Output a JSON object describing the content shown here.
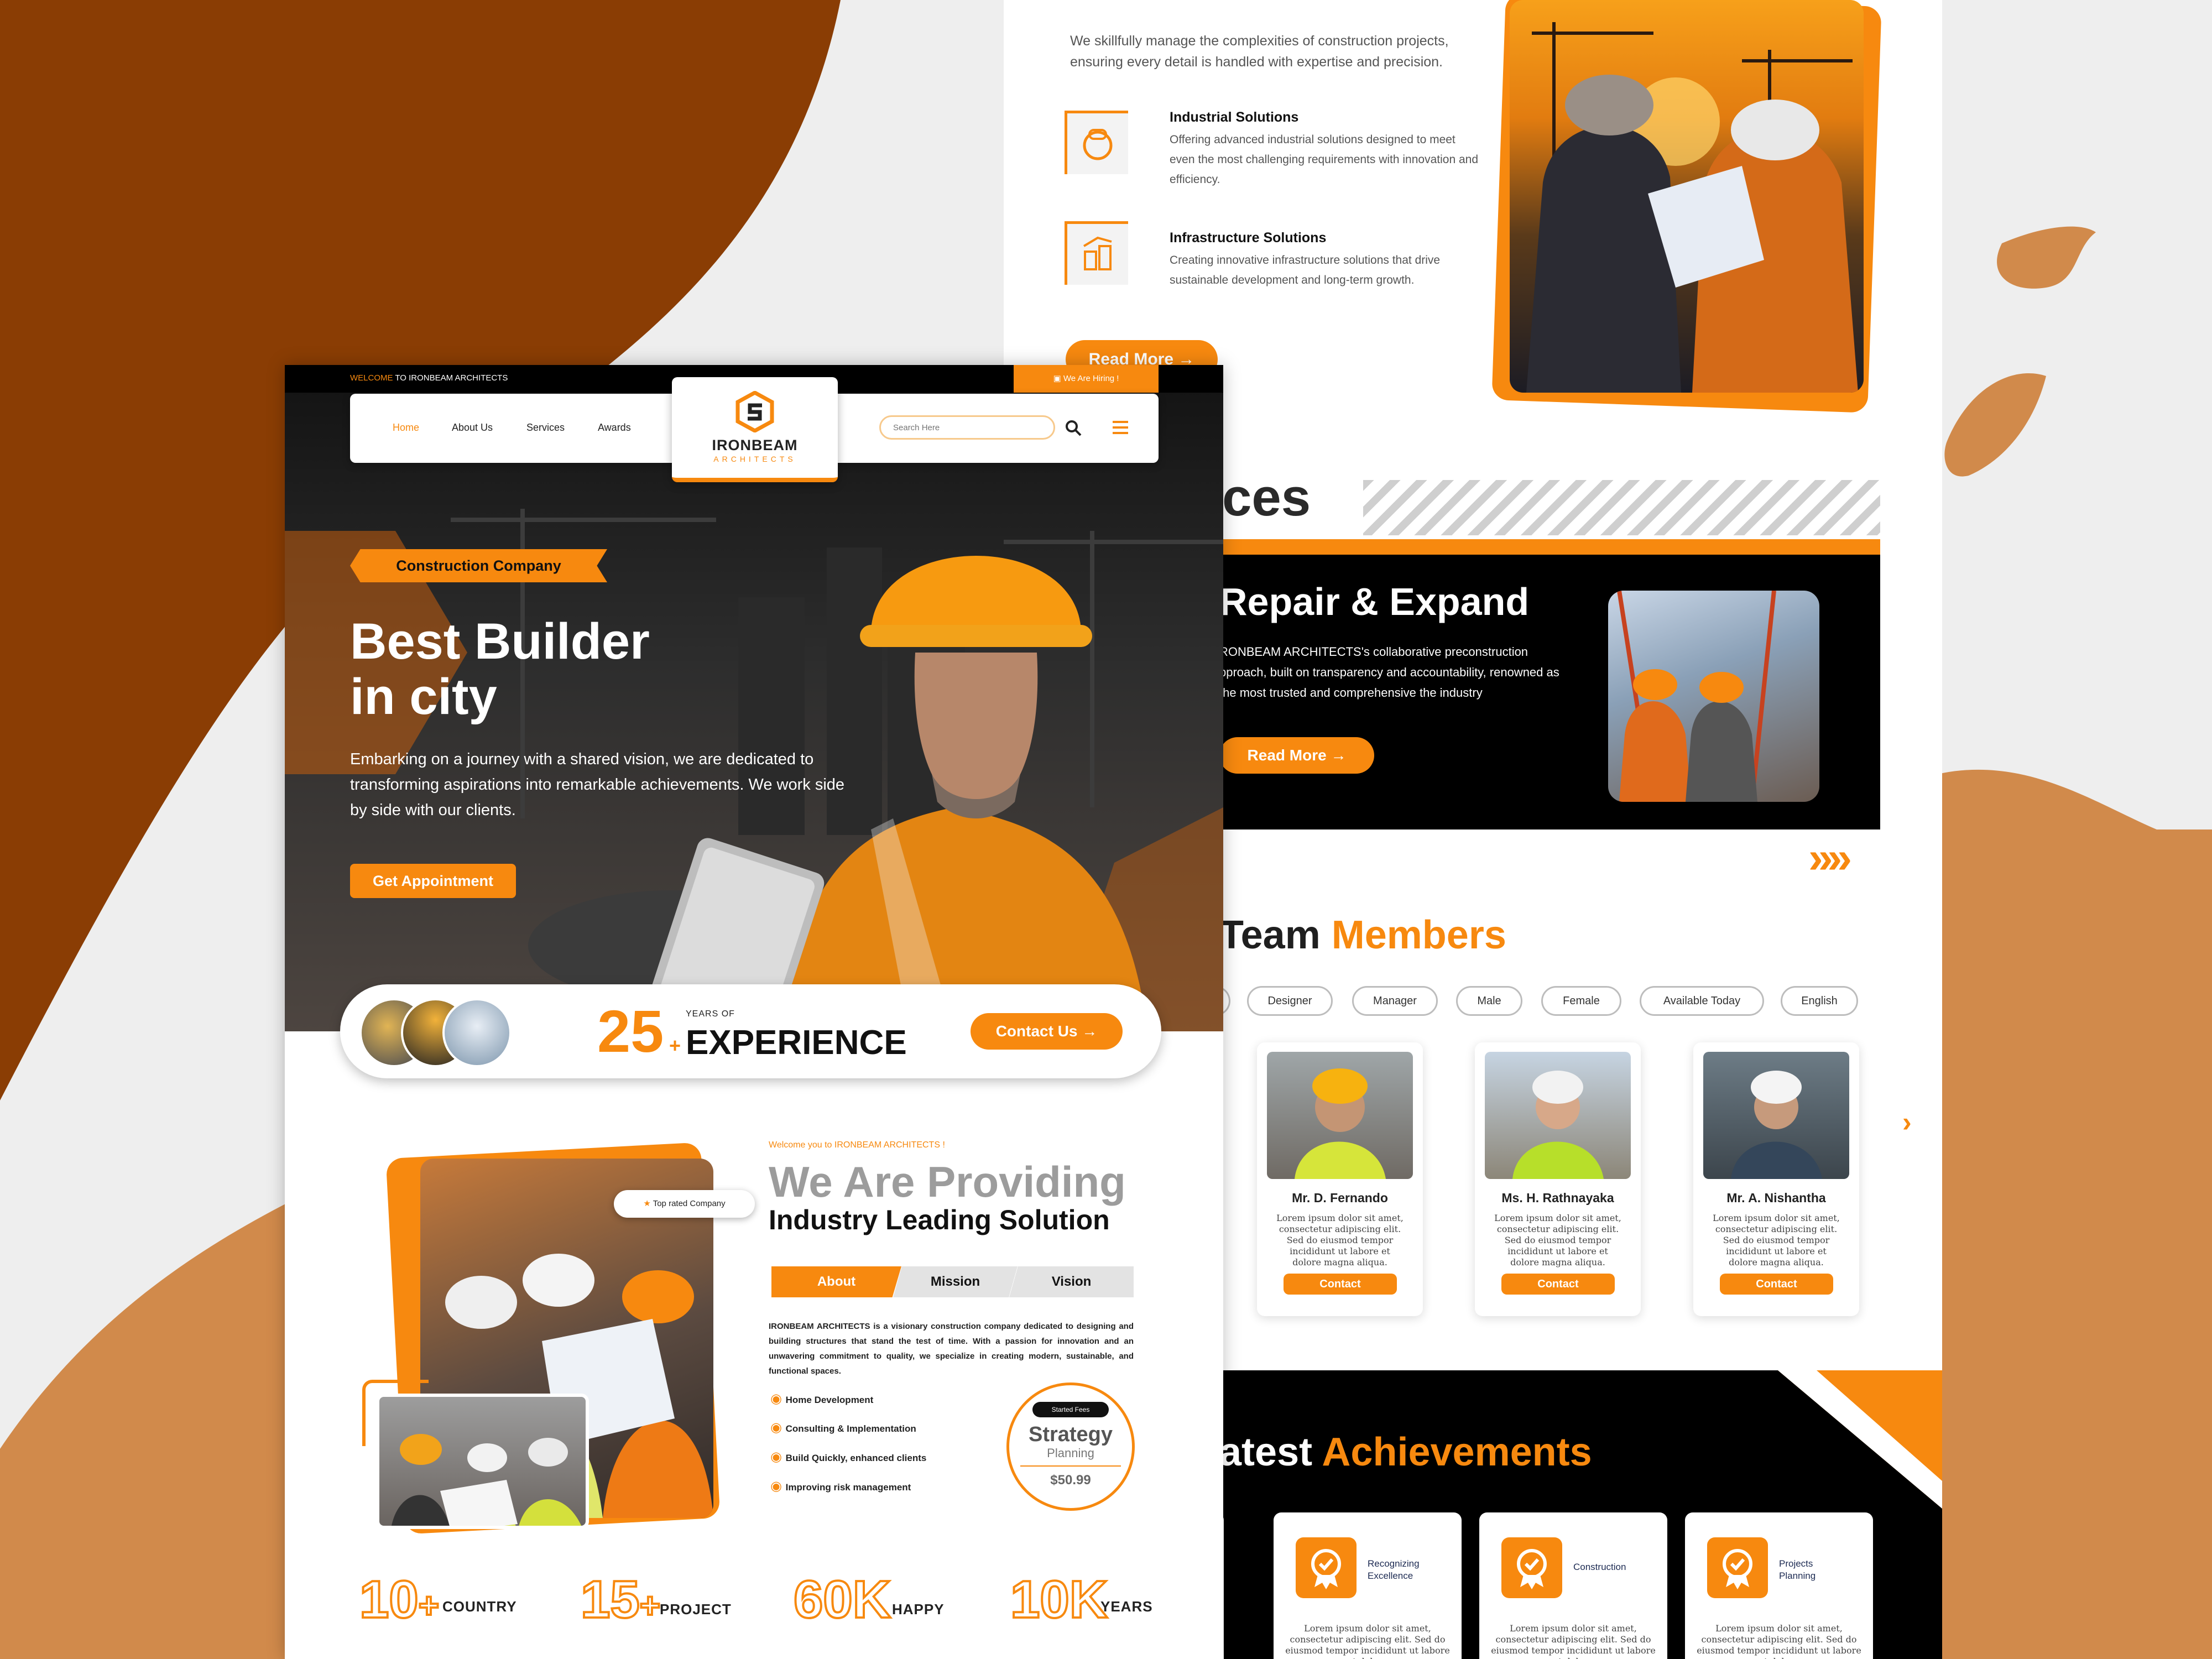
{
  "colors": {
    "accent": "#f7890f",
    "dark_brown": "#8a3d04",
    "tan": "#d18a4b",
    "black": "#000000"
  },
  "right_page": {
    "intro": "We skillfully manage the complexities of construction projects, ensuring every detail is handled with expertise and precision.",
    "features": [
      {
        "icon": "gear-worker-icon",
        "title": "Industrial Solutions",
        "desc": "Offering advanced industrial solutions designed to meet even the most challenging requirements with innovation and efficiency."
      },
      {
        "icon": "building-chart-icon",
        "title": "Infrastructure Solutions",
        "desc": "Creating innovative infrastructure solutions that drive sustainable development and long-term growth."
      }
    ],
    "read_more_1": "Read More →",
    "services_heading": "ces",
    "service_title": "Repair & Expand",
    "service_desc": "RONBEAM ARCHITECTS's collaborative preconstruction pproach, built on transparency and accountability, renowned as the most trusted and comprehensive the industry",
    "read_more_2": "Read More →",
    "next_arrows": "»»",
    "team_heading_a": "Team ",
    "team_heading_b": "Members",
    "filters": [
      "Designer",
      "Manager",
      "Male",
      "Female",
      "Available Today",
      "English"
    ],
    "members": [
      {
        "name": "Mr. D. Fernando",
        "desc": "Lorem ipsum dolor sit amet, consectetur adipiscing elit. Sed do eiusmod tempor incididunt ut labore et dolore magna aliqua.",
        "button": "Contact"
      },
      {
        "name": "Ms. H. Rathnayaka",
        "desc": "Lorem ipsum dolor sit amet, consectetur adipiscing elit. Sed do eiusmod tempor incididunt ut labore et dolore magna aliqua.",
        "button": "Contact"
      },
      {
        "name": "Mr. A. Nishantha",
        "desc": "Lorem ipsum dolor sit amet, consectetur adipiscing elit. Sed do eiusmod tempor incididunt ut labore et dolore magna aliqua.",
        "button": "Contact"
      }
    ],
    "team_next": "›",
    "achievements_a": "atest ",
    "achievements_b": "Achievements",
    "achievements": [
      {
        "title": "Recognizing Excellence",
        "desc": "Lorem ipsum dolor sit amet, consectetur adipiscing elit. Sed do eiusmod tempor incididunt ut labore et dolore"
      },
      {
        "title": "Construction",
        "desc": "Lorem ipsum dolor sit amet, consectetur adipiscing elit. Sed do eiusmod tempor incididunt ut labore et dolore"
      },
      {
        "title": "Projects Planning",
        "desc": "Lorem ipsum dolor sit amet, consectetur adipiscing elit. Sed do eiusmod tempor incididunt ut labore et dolore"
      }
    ]
  },
  "left_page": {
    "topbar_welcome": "WELCOME",
    "topbar_rest": " TO IRONBEAM ARCHITECTS",
    "hiring": "We Are Hiring !",
    "nav": [
      "Home",
      "About Us",
      "Services",
      "Awards"
    ],
    "logo_name": "IRONBEAM",
    "logo_sub": "ARCHITECTS",
    "search_placeholder": "Search Here",
    "badge": "Construction Company",
    "hero_title_1": "Best Builder",
    "hero_title_2": "in city",
    "hero_desc": "Embarking on a journey with a shared vision, we are dedicated to transforming aspirations into remarkable achievements. We work side by side with our clients.",
    "cta": "Get Appointment",
    "years_num": "25",
    "years_plus": "+",
    "years_small": "YEARS OF",
    "years_word": "EXPERIENCE",
    "contact_btn": "Contact Us →",
    "top_rated": "Top rated Company",
    "welcome_small": "Welcome you to IRONBEAM ARCHITECTS !",
    "about_heading_1": "We Are Providing",
    "about_heading_2": "Industry Leading Solution",
    "tabs": [
      "About",
      "Mission",
      "Vision"
    ],
    "about_text": "IRONBEAM ARCHITECTS is a visionary construction company dedicated to designing and building structures that stand the test of time. With a passion for innovation and an unwavering commitment to quality, we specialize in creating modern, sustainable, and functional spaces.",
    "checklist": [
      "Home Development",
      "Consulting & Implementation",
      "Build Quickly, enhanced clients",
      "Improving risk management"
    ],
    "strategy_tag": "Started Fees",
    "strategy_title": "Strategy",
    "strategy_sub": "Planning",
    "strategy_price": "$50.99",
    "stats": [
      {
        "num": "10",
        "suffix": "+",
        "label": "COUNTRY"
      },
      {
        "num": "15",
        "suffix": "+",
        "label": "PROJECT"
      },
      {
        "num": "60",
        "suffix": "K",
        "label": "HAPPY"
      },
      {
        "num": "10",
        "suffix": "K",
        "label": "YEARS"
      }
    ]
  }
}
